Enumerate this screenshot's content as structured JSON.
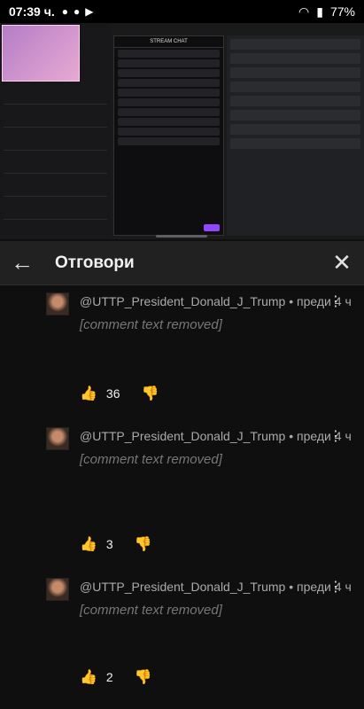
{
  "status_bar": {
    "time": "07:39 ч.",
    "battery": "77%"
  },
  "panel": {
    "title": "Отговори"
  },
  "comments": [
    {
      "author": "@UTTP_President_Donald_J_Trump",
      "age": "преди 4 ч",
      "text": "[comment text removed]",
      "likes": "36"
    },
    {
      "author": "@UTTP_President_Donald_J_Trump",
      "age": "преди 4 ч",
      "text": "[comment text removed]",
      "likes": "3"
    },
    {
      "author": "@UTTP_President_Donald_J_Trump",
      "age": "преди 4 ч",
      "text": "[comment text removed]",
      "likes": "2"
    }
  ]
}
